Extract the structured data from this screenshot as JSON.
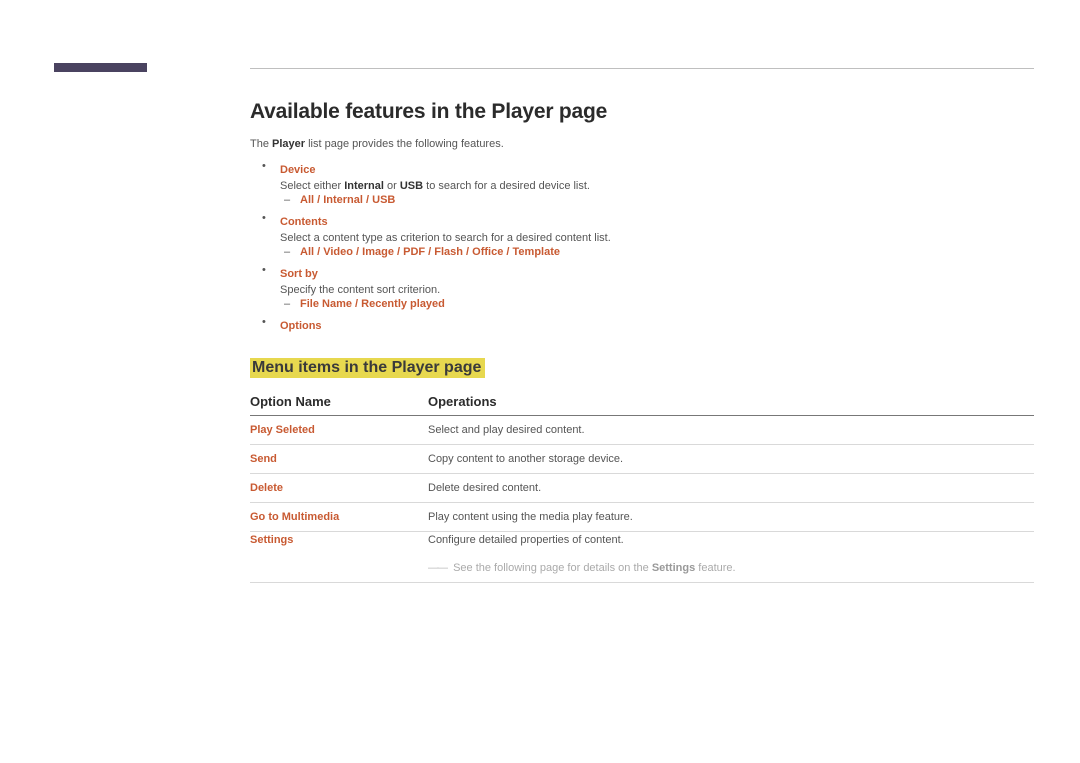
{
  "section_title": "Available features in the Player page",
  "intro_pre": "The ",
  "intro_bold": "Player",
  "intro_post": " list page provides the following features.",
  "features": {
    "device": {
      "title": "Device",
      "desc_pre": "Select either ",
      "desc_mid1": "Internal",
      "desc_or": " or ",
      "desc_mid2": "USB",
      "desc_post": " to search for a desired device list.",
      "sub": "All / Internal / USB"
    },
    "contents": {
      "title": "Contents",
      "desc": "Select a content type as criterion to search for a desired content list.",
      "sub": "All / Video / Image / PDF / Flash / Office / Template"
    },
    "sortby": {
      "title": "Sort by",
      "desc": "Specify the content sort criterion.",
      "sub": "File Name / Recently played"
    },
    "options": {
      "title": "Options"
    }
  },
  "subsection_title": "Menu items in the Player page",
  "table": {
    "col1": "Option Name",
    "col2": "Operations",
    "rows": [
      {
        "name": "Play Seleted",
        "op": "Select and play desired content."
      },
      {
        "name": "Send",
        "op": "Copy content to another storage device."
      },
      {
        "name": "Delete",
        "op": "Delete desired content."
      },
      {
        "name": "Go to Multimedia",
        "op": "Play content using the media play feature."
      },
      {
        "name": "Settings",
        "op": "Configure detailed properties of content."
      }
    ],
    "note_pre": "See the following page for details on the ",
    "note_bold": "Settings",
    "note_post": " feature."
  }
}
